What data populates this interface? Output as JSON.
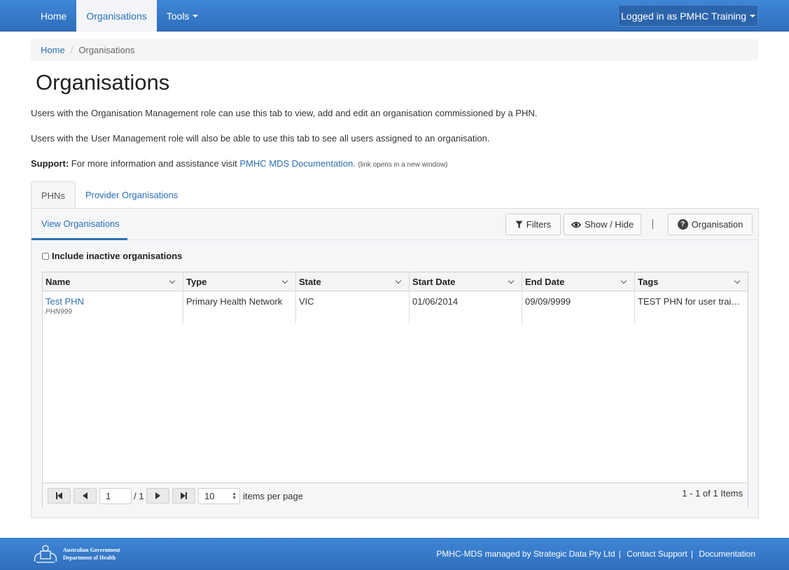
{
  "navbar": {
    "items": [
      {
        "label": "Home"
      },
      {
        "label": "Organisations"
      },
      {
        "label": "Tools"
      }
    ],
    "active": "Organisations",
    "user_label": "Logged in as PMHC Training"
  },
  "breadcrumb": {
    "home": "Home",
    "current": "Organisations"
  },
  "page": {
    "title": "Organisations",
    "para1": "Users with the Organisation Management role can use this tab to view, add and edit an organisation commissioned by a PHN.",
    "para2": "Users with the User Management role will also be able to use this tab to see all users assigned to an organisation.",
    "support_label": "Support:",
    "support_text": "For more information and assistance visit",
    "support_link": "PMHC MDS Documentation.",
    "support_note": "(link opens in a new window)"
  },
  "tabs": [
    {
      "label": "PHNs",
      "active": true
    },
    {
      "label": "Provider Organisations",
      "active": false
    }
  ],
  "panel": {
    "subtab": "View Organisations",
    "filters_label": "Filters",
    "show_hide_label": "Show / Hide",
    "organisation_label": "Organisation",
    "include_inactive_label": "Include inactive organisations"
  },
  "grid": {
    "columns": [
      "Name",
      "Type",
      "State",
      "Start Date",
      "End Date",
      "Tags"
    ],
    "rows": [
      {
        "name": "Test PHN",
        "code": "PHN999",
        "type": "Primary Health Network",
        "state": "VIC",
        "start_date": "01/06/2014",
        "end_date": "09/09/9999",
        "tags": "TEST PHN for user training"
      }
    ]
  },
  "pager": {
    "page": "1",
    "total_pages": "/ 1",
    "page_size": "10",
    "items_per_page_label": "items per page",
    "summary": "1 - 1 of 1 Items"
  },
  "footer": {
    "logo_line1": "Australian Government",
    "logo_line2": "Department of Health",
    "managed_by": "PMHC-MDS managed by Strategic Data Pty Ltd",
    "contact_support": "Contact Support",
    "documentation": "Documentation"
  },
  "colors": {
    "navbar": "#3a7ecb",
    "link": "#2a6fb6",
    "active_tab_bg": "#f3f5f8"
  },
  "icons": [
    "filter-icon",
    "eye-icon",
    "help-icon",
    "caret-down-icon",
    "chevron-down-icon",
    "first-page-icon",
    "prev-page-icon",
    "next-page-icon",
    "last-page-icon",
    "crest-icon"
  ]
}
